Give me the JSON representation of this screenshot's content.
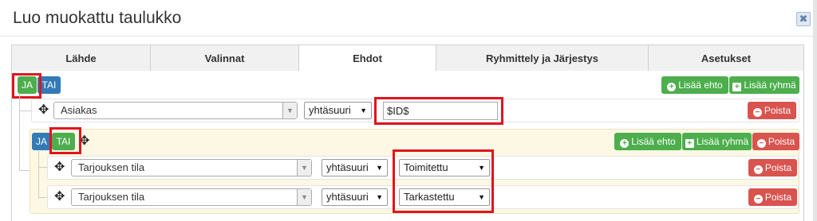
{
  "dialog": {
    "title": "Luo muokattu taulukko",
    "close": "✖"
  },
  "tabs": [
    "Lähde",
    "Valinnat",
    "Ehdot",
    "Ryhmittely ja Järjestys",
    "Asetukset"
  ],
  "root": {
    "and_label": "JA",
    "or_label": "TAI",
    "add_rule": "Lisää ehto",
    "add_group": "Lisää ryhmä",
    "rule": {
      "field": "Asiakas",
      "operator": "yhtäsuuri",
      "value": "$ID$",
      "delete": "Poista"
    }
  },
  "group": {
    "and_label": "JA",
    "or_label": "TAI",
    "add_rule": "Lisää ehto",
    "add_group": "Lisää ryhmä",
    "delete": "Poista",
    "rules": [
      {
        "field": "Tarjouksen tila",
        "operator": "yhtäsuuri",
        "value": "Toimitettu",
        "delete": "Poista"
      },
      {
        "field": "Tarjouksen tila",
        "operator": "yhtäsuuri",
        "value": "Tarkastettu",
        "delete": "Poista"
      }
    ]
  },
  "icons": {
    "move": "move-icon",
    "plus_circle": "plus-circle-icon",
    "plus_square": "plus-square-icon",
    "minus_circle": "minus-circle-icon"
  }
}
